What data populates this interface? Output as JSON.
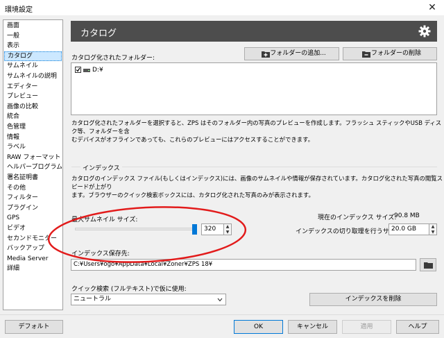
{
  "window": {
    "title": "環境設定",
    "close_glyph": "✕"
  },
  "sidebar": {
    "items": [
      {
        "label": "画面"
      },
      {
        "label": "一般"
      },
      {
        "label": "表示"
      },
      {
        "label": "カタログ",
        "selected": true
      },
      {
        "label": "サムネイル"
      },
      {
        "label": "サムネイルの説明"
      },
      {
        "label": "エディター"
      },
      {
        "label": "プレビュー"
      },
      {
        "label": "画像の比較"
      },
      {
        "label": "統合"
      },
      {
        "label": "色管理"
      },
      {
        "label": "情報"
      },
      {
        "label": "ラベル"
      },
      {
        "label": "RAW フォーマット"
      },
      {
        "label": "ヘルパープログラム"
      },
      {
        "label": "署名証明書"
      },
      {
        "label": "その他"
      },
      {
        "label": "フィルター"
      },
      {
        "label": "プラグイン"
      },
      {
        "label": "GPS"
      },
      {
        "label": "ビデオ"
      },
      {
        "label": "セカンドモニター"
      },
      {
        "label": "バックアップ"
      },
      {
        "label": "Media Server"
      },
      {
        "label": "詳細"
      }
    ]
  },
  "header": {
    "title": "カタログ",
    "icon": "gear-icon"
  },
  "catalog": {
    "folders_label": "カタログ化されたフォルダー:",
    "add_folder_label": "フォルダーの追加...",
    "remove_folder_label": "フォルダーの削除",
    "folders": [
      {
        "name": "D:¥",
        "checked": true
      }
    ],
    "description_1": "カタログ化されたフォルダーを選択すると、ZPS はそのフォルダー内の写真のプレビューを作成します。フラッシュ スティックやUSB ディスク等、フォルダーを含",
    "description_2": "むデバイスがオフラインであっても、これらのプレビューにはアクセスすることができます。"
  },
  "index": {
    "section_title": "インデックス",
    "description_1": "カタログのインデックス ファイル(もしくはインデックス)には、画像のサムネイルや情報が保存されています。カタログ化された写真の閲覧スピードが上がり",
    "description_2": "ます。ブラウザーのクイック検索ボックスには、カタログ化された写真のみが表示されます。",
    "max_thumb_label": "最大サムネイル サイズ:",
    "max_thumb_value": "320",
    "slider_fraction": 1.0,
    "current_size_label": "現在のインデックス サイズ:",
    "current_size_value": "90.8 MB",
    "trim_label": "インデックスの切り取理を行うサイズ:",
    "trim_value": "20.0 GB",
    "location_label": "インデックス保存先:",
    "location_value": "C:¥Users¥ogo¥AppData¥Local¥Zoner¥ZPS 18¥",
    "quick_search_label": "クイック検索 (フルテキスト)で仮に使用:",
    "quick_search_value": "ニュートラル",
    "delete_index_label": "インデックスを削除"
  },
  "footer": {
    "default_label": "デフォルト",
    "ok_label": "OK",
    "cancel_label": "キャンセル",
    "apply_label": "適用",
    "help_label": "ヘルプ"
  },
  "colors": {
    "header_bg": "#4d4d4d",
    "selection": "#cce8ff",
    "slider_thumb": "#0078d7",
    "annotation": "#e21b1b"
  }
}
